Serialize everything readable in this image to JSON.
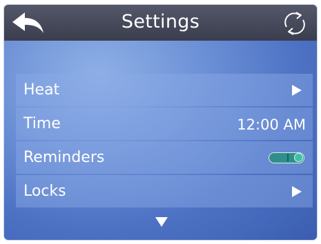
{
  "header": {
    "title": "Settings",
    "back_icon": "back-arrow-icon",
    "refresh_icon": "refresh-icon"
  },
  "settings": [
    {
      "label": "Heat",
      "control": "arrow"
    },
    {
      "label": "Time",
      "control": "value",
      "value": "12:00 AM"
    },
    {
      "label": "Reminders",
      "control": "toggle",
      "toggle_on": true
    },
    {
      "label": "Locks",
      "control": "arrow"
    }
  ],
  "colors": {
    "header_bg": "#3a3d4d",
    "panel_bg": "#5a7ecb",
    "toggle_on": "#2f8f8a",
    "text": "#ffffff"
  },
  "scroll": {
    "icon": "scroll-down-icon"
  }
}
